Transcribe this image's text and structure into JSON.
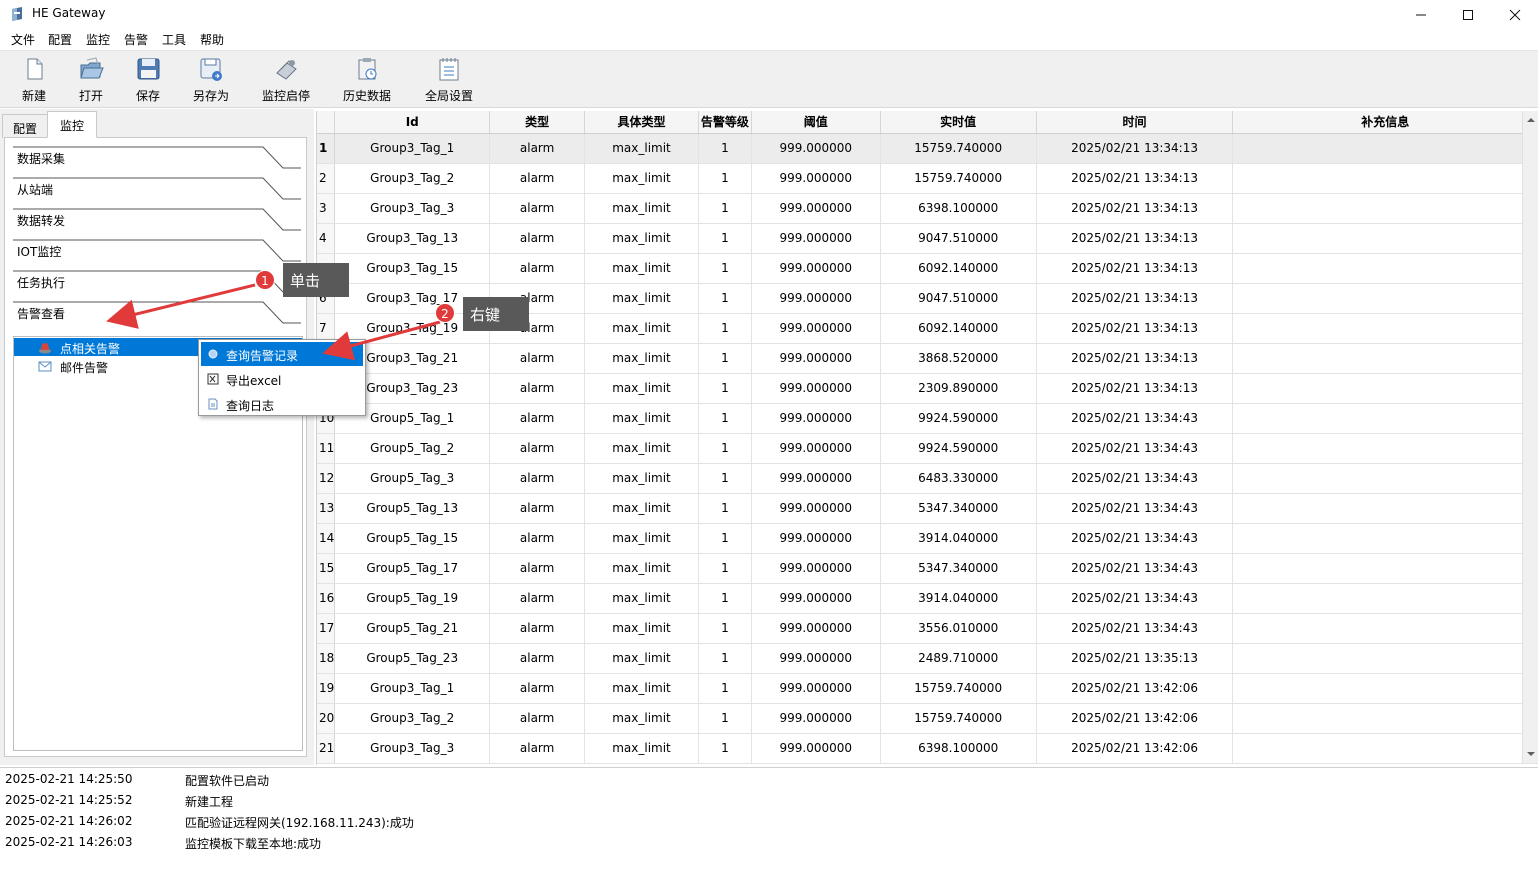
{
  "window": {
    "title": "HE Gateway"
  },
  "menu": [
    "文件",
    "配置",
    "监控",
    "告警",
    "工具",
    "帮助"
  ],
  "toolbar": [
    {
      "label": "新建",
      "icon": "new-file-icon"
    },
    {
      "label": "打开",
      "icon": "open-folder-icon"
    },
    {
      "label": "保存",
      "icon": "save-icon"
    },
    {
      "label": "另存为",
      "icon": "save-as-icon"
    },
    {
      "label": "监控启停",
      "icon": "monitor-toggle-icon"
    },
    {
      "label": "历史数据",
      "icon": "history-data-icon"
    },
    {
      "label": "全局设置",
      "icon": "global-settings-icon"
    }
  ],
  "left_tabs": [
    {
      "label": "配置"
    },
    {
      "label": "监控",
      "active": true
    }
  ],
  "sections": [
    "数据采集",
    "从站端",
    "数据转发",
    "IOT监控",
    "任务执行",
    "告警查看"
  ],
  "tree": [
    {
      "label": "点相关告警",
      "icon": "alarm-bell-icon",
      "selected": true
    },
    {
      "label": "邮件告警",
      "icon": "mail-icon"
    }
  ],
  "context_menu": [
    {
      "label": "查询告警记录",
      "icon": "query-alarm-icon",
      "highlighted": true
    },
    {
      "label": "导出excel",
      "icon": "excel-icon"
    },
    {
      "label": "查询日志",
      "icon": "log-icon"
    }
  ],
  "annotations": [
    {
      "number": "1",
      "text": "单击"
    },
    {
      "number": "2",
      "text": "右键"
    }
  ],
  "table": {
    "columns": [
      "Id",
      "类型",
      "具体类型",
      "告警等级",
      "阈值",
      "实时值",
      "时间",
      "补充信息"
    ],
    "rows": [
      [
        "1",
        "Group3_Tag_1",
        "alarm",
        "max_limit",
        "1",
        "999.000000",
        "15759.740000",
        "2025/02/21 13:34:13",
        ""
      ],
      [
        "2",
        "Group3_Tag_2",
        "alarm",
        "max_limit",
        "1",
        "999.000000",
        "15759.740000",
        "2025/02/21 13:34:13",
        ""
      ],
      [
        "3",
        "Group3_Tag_3",
        "alarm",
        "max_limit",
        "1",
        "999.000000",
        "6398.100000",
        "2025/02/21 13:34:13",
        ""
      ],
      [
        "4",
        "Group3_Tag_13",
        "alarm",
        "max_limit",
        "1",
        "999.000000",
        "9047.510000",
        "2025/02/21 13:34:13",
        ""
      ],
      [
        "5",
        "Group3_Tag_15",
        "alarm",
        "max_limit",
        "1",
        "999.000000",
        "6092.140000",
        "2025/02/21 13:34:13",
        ""
      ],
      [
        "6",
        "Group3_Tag_17",
        "alarm",
        "max_limit",
        "1",
        "999.000000",
        "9047.510000",
        "2025/02/21 13:34:13",
        ""
      ],
      [
        "7",
        "Group3_Tag_19",
        "alarm",
        "max_limit",
        "1",
        "999.000000",
        "6092.140000",
        "2025/02/21 13:34:13",
        ""
      ],
      [
        "8",
        "Group3_Tag_21",
        "alarm",
        "max_limit",
        "1",
        "999.000000",
        "3868.520000",
        "2025/02/21 13:34:13",
        ""
      ],
      [
        "9",
        "Group3_Tag_23",
        "alarm",
        "max_limit",
        "1",
        "999.000000",
        "2309.890000",
        "2025/02/21 13:34:13",
        ""
      ],
      [
        "10",
        "Group5_Tag_1",
        "alarm",
        "max_limit",
        "1",
        "999.000000",
        "9924.590000",
        "2025/02/21 13:34:43",
        ""
      ],
      [
        "11",
        "Group5_Tag_2",
        "alarm",
        "max_limit",
        "1",
        "999.000000",
        "9924.590000",
        "2025/02/21 13:34:43",
        ""
      ],
      [
        "12",
        "Group5_Tag_3",
        "alarm",
        "max_limit",
        "1",
        "999.000000",
        "6483.330000",
        "2025/02/21 13:34:43",
        ""
      ],
      [
        "13",
        "Group5_Tag_13",
        "alarm",
        "max_limit",
        "1",
        "999.000000",
        "5347.340000",
        "2025/02/21 13:34:43",
        ""
      ],
      [
        "14",
        "Group5_Tag_15",
        "alarm",
        "max_limit",
        "1",
        "999.000000",
        "3914.040000",
        "2025/02/21 13:34:43",
        ""
      ],
      [
        "15",
        "Group5_Tag_17",
        "alarm",
        "max_limit",
        "1",
        "999.000000",
        "5347.340000",
        "2025/02/21 13:34:43",
        ""
      ],
      [
        "16",
        "Group5_Tag_19",
        "alarm",
        "max_limit",
        "1",
        "999.000000",
        "3914.040000",
        "2025/02/21 13:34:43",
        ""
      ],
      [
        "17",
        "Group5_Tag_21",
        "alarm",
        "max_limit",
        "1",
        "999.000000",
        "3556.010000",
        "2025/02/21 13:34:43",
        ""
      ],
      [
        "18",
        "Group5_Tag_23",
        "alarm",
        "max_limit",
        "1",
        "999.000000",
        "2489.710000",
        "2025/02/21 13:35:13",
        ""
      ],
      [
        "19",
        "Group3_Tag_1",
        "alarm",
        "max_limit",
        "1",
        "999.000000",
        "15759.740000",
        "2025/02/21 13:42:06",
        ""
      ],
      [
        "20",
        "Group3_Tag_2",
        "alarm",
        "max_limit",
        "1",
        "999.000000",
        "15759.740000",
        "2025/02/21 13:42:06",
        ""
      ],
      [
        "21",
        "Group3_Tag_3",
        "alarm",
        "max_limit",
        "1",
        "999.000000",
        "6398.100000",
        "2025/02/21 13:42:06",
        ""
      ]
    ]
  },
  "log": [
    {
      "time": "2025-02-21 14:25:50",
      "message": "配置软件已启动"
    },
    {
      "time": "2025-02-21 14:25:52",
      "message": "新建工程"
    },
    {
      "time": "2025-02-21 14:26:02",
      "message": "匹配验证远程网关(192.168.11.243):成功"
    },
    {
      "time": "2025-02-21 14:26:03",
      "message": "监控模板下载至本地:成功"
    }
  ],
  "colors": {
    "highlight": "#0078d7",
    "annotation_arrow": "#e03a3a",
    "callout_bg": "#595959"
  }
}
